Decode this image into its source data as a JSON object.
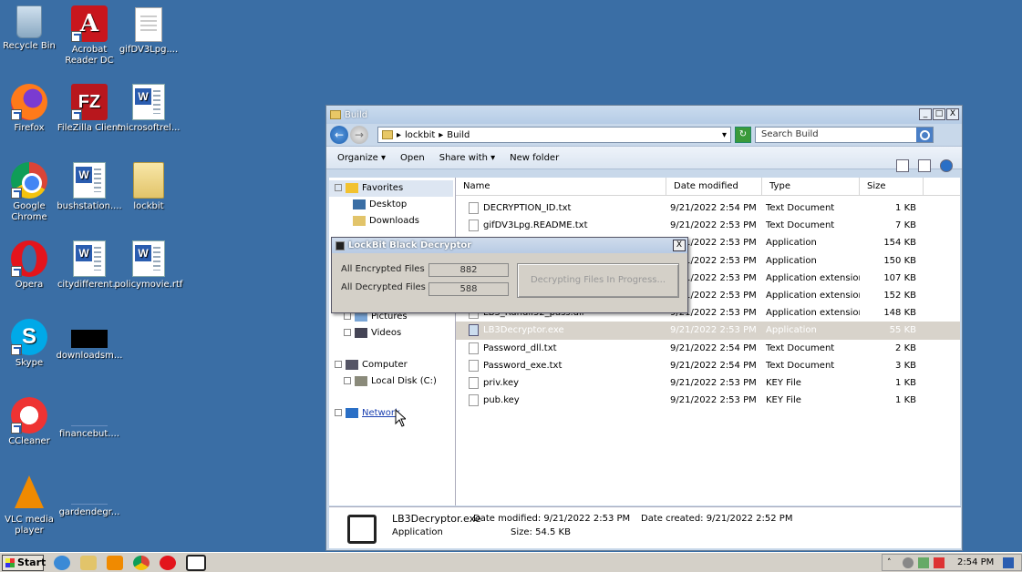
{
  "desktop": {
    "icons": [
      {
        "label": "Recycle Bin",
        "icon": "recycle-bin-icon"
      },
      {
        "label": "Acrobat Reader DC",
        "icon": "acrobat-icon"
      },
      {
        "label": "gifDV3Lpg....",
        "icon": "text-file-icon"
      },
      {
        "label": "Firefox",
        "icon": "firefox-icon"
      },
      {
        "label": "FileZilla Client",
        "icon": "filezilla-icon"
      },
      {
        "label": "microsoftrel...",
        "icon": "word-doc-icon"
      },
      {
        "label": "Google Chrome",
        "icon": "chrome-icon"
      },
      {
        "label": "bushstation....",
        "icon": "word-doc-icon"
      },
      {
        "label": "lockbit",
        "icon": "folder-icon"
      },
      {
        "label": "Opera",
        "icon": "opera-icon"
      },
      {
        "label": "citydifferent...",
        "icon": "word-doc-icon"
      },
      {
        "label": "policymovie.rtf",
        "icon": "word-doc-icon"
      },
      {
        "label": "Skype",
        "icon": "skype-icon"
      },
      {
        "label": "downloadsm...",
        "icon": "black-thumbnail-icon"
      },
      {
        "label": "CCleaner",
        "icon": "ccleaner-icon"
      },
      {
        "label": "financebut....",
        "icon": "blank-file-icon"
      },
      {
        "label": "VLC media player",
        "icon": "vlc-icon"
      },
      {
        "label": "gardendegr...",
        "icon": "blank-file-icon"
      }
    ]
  },
  "explorer": {
    "title": "Build",
    "window_buttons": {
      "minimize": "_",
      "maximize": "□",
      "close": "X"
    },
    "breadcrumb": [
      "lockbit",
      "Build"
    ],
    "search_placeholder": "Search Build",
    "toolbar": {
      "organize": "Organize ▾",
      "open": "Open",
      "share_with": "Share with ▾",
      "new_folder": "New folder"
    },
    "nav": {
      "favorites": "Favorites",
      "desktop": "Desktop",
      "downloads": "Downloads",
      "pictures": "Pictures",
      "videos": "Videos",
      "computer": "Computer",
      "local_disk": "Local Disk (C:)",
      "network": "Network"
    },
    "columns": {
      "name": "Name",
      "date": "Date modified",
      "type": "Type",
      "size": "Size"
    },
    "files": [
      {
        "name": "DECRYPTION_ID.txt",
        "date": "9/21/2022 2:54 PM",
        "type": "Text Document",
        "size": "1 KB"
      },
      {
        "name": "gifDV3Lpg.README.txt",
        "date": "9/21/2022 2:53 PM",
        "type": "Text Document",
        "size": "7 KB"
      },
      {
        "name": "",
        "date": "9/21/2022 2:53 PM",
        "type": "Application",
        "size": "154 KB"
      },
      {
        "name": "",
        "date": "9/21/2022 2:53 PM",
        "type": "Application",
        "size": "150 KB"
      },
      {
        "name": "",
        "date": "9/21/2022 2:53 PM",
        "type": "Application extension",
        "size": "107 KB"
      },
      {
        "name": "",
        "date": "9/21/2022 2:53 PM",
        "type": "Application extension",
        "size": "152 KB"
      },
      {
        "name": "LB3_Rundll32_pass.dll",
        "date": "9/21/2022 2:53 PM",
        "type": "Application extension",
        "size": "148 KB"
      },
      {
        "name": "LB3Decryptor.exe",
        "date": "9/21/2022 2:53 PM",
        "type": "Application",
        "size": "55 KB"
      },
      {
        "name": "Password_dll.txt",
        "date": "9/21/2022 2:54 PM",
        "type": "Text Document",
        "size": "2 KB"
      },
      {
        "name": "Password_exe.txt",
        "date": "9/21/2022 2:54 PM",
        "type": "Text Document",
        "size": "3 KB"
      },
      {
        "name": "priv.key",
        "date": "9/21/2022 2:53 PM",
        "type": "KEY File",
        "size": "1 KB"
      },
      {
        "name": "pub.key",
        "date": "9/21/2022 2:53 PM",
        "type": "KEY File",
        "size": "1 KB"
      }
    ],
    "details": {
      "filename": "LB3Decryptor.exe",
      "type": "Application",
      "modified": "Date modified: 9/21/2022 2:53 PM",
      "size": "Size: 54.5 KB",
      "created": "Date created: 9/21/2022 2:52 PM"
    }
  },
  "decryptor": {
    "title": "LockBit Black Decryptor",
    "close": "X",
    "encrypted_label": "All Encrypted Files",
    "encrypted_value": "882",
    "decrypted_label": "All Decrypted Files",
    "decrypted_value": "588",
    "progress_button": "Decrypting Files In Progress..."
  },
  "taskbar": {
    "start": "Start",
    "clock": "2:54 PM"
  }
}
